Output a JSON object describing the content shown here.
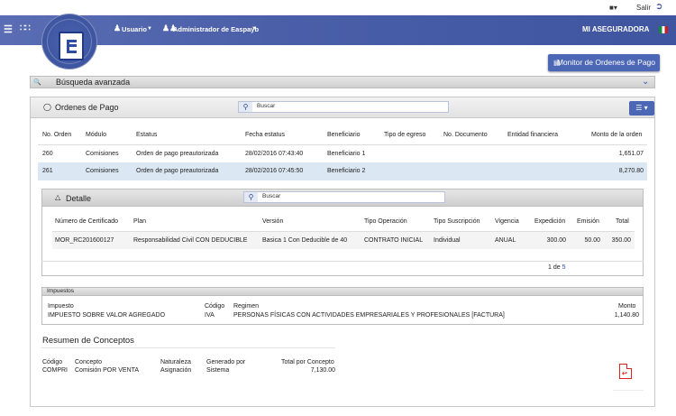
{
  "topbar": {
    "salir": "Salir"
  },
  "header": {
    "usuario": "Usuario",
    "admin": "Administrador de Easpayb",
    "company": "MI ASEGURADORA"
  },
  "monitor_button": "Monitor de Ordenes de Pago",
  "busqueda": {
    "title": "Búsqueda avanzada"
  },
  "ordenes": {
    "title": "Ordenes de Pago",
    "search_placeholder": "Buscar",
    "columns": [
      "No. Orden",
      "Módulo",
      "Estatus",
      "Fecha estatus",
      "Beneficiario",
      "Tipo de egreso",
      "No. Documento",
      "Entidad financiera",
      "Monto de la orden"
    ],
    "rows": [
      [
        "260",
        "Comisiones",
        "Orden de pago preautorizada",
        "28/02/2016 07:43:40",
        "Beneficiario 1",
        "",
        "",
        "",
        "1,651.07"
      ],
      [
        "261",
        "Comisiones",
        "Orden de pago preautorizada",
        "28/02/2016 07:45:50",
        "Beneficiario 2",
        "",
        "",
        "",
        "8,270.80"
      ]
    ]
  },
  "detalle": {
    "title": "Detalle",
    "search_placeholder": "Buscar",
    "columns": [
      "Número de Certificado",
      "Plan",
      "Versión",
      "Tipo Operación",
      "Tipo Suscripción",
      "Vigencia",
      "Expedición",
      "Emisión",
      "Total"
    ],
    "row": [
      "MOR_RC201600127",
      "Responsabilidad Civil CON DEDUCIBLE",
      "Basica 1 Con Deducible de 40",
      "CONTRATO INICIAL",
      "Individual",
      "ANUAL",
      "300.00",
      "50.00",
      "350.00"
    ],
    "pager_current": "1",
    "pager_de": "de",
    "pager_total": "5"
  },
  "impuestos": {
    "title": "Impuestos",
    "h_impuesto": "Impuesto",
    "h_codigo": "Código",
    "h_regimen": "Regimen",
    "h_monto": "Monto",
    "impuesto": "IMPUESTO SOBRE VALOR AGREGADO",
    "codigo": "IVA",
    "regimen": "PERSONAS FÍSICAS CON ACTIVIDADES EMPRESARIALES Y PROFESIONALES [FACTURA]",
    "monto": "1,140.80"
  },
  "resumen": {
    "title": "Resumen de Conceptos",
    "h_codigo": "Código",
    "h_concepto": "Concepto",
    "h_naturaleza": "Naturaleza",
    "h_generado": "Generado por",
    "h_total": "Total por Concepto",
    "codigo": "COMPRI",
    "concepto": "Comisión POR VENTA",
    "naturaleza": "Asignación",
    "generado": "Sistema",
    "total": "7,130.00"
  },
  "colors": {
    "header": "#4a5fa8",
    "button": "#4c67b5",
    "row_selected": "#dbe7f3",
    "pdf": "#d9251d"
  }
}
